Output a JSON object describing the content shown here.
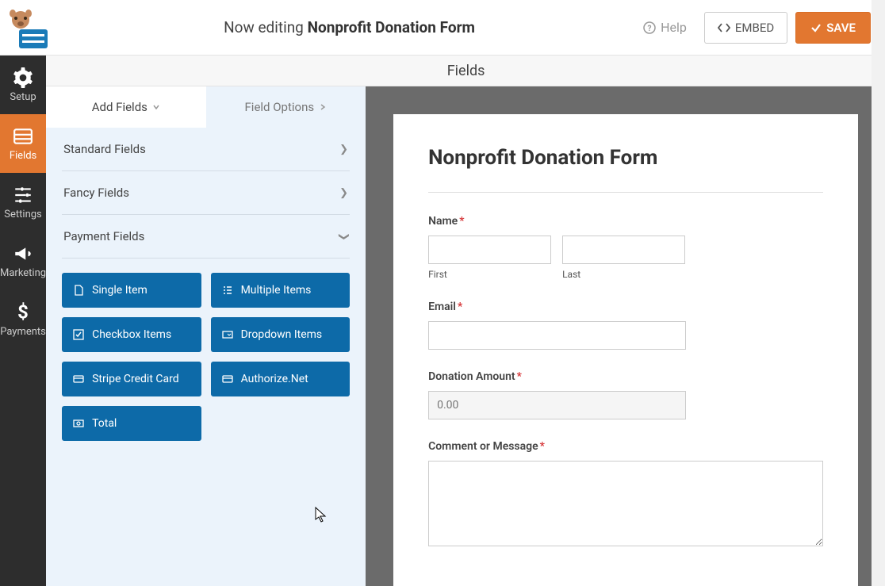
{
  "top": {
    "editing_prefix": "Now editing ",
    "form_name": "Nonprofit Donation Form",
    "help": "Help",
    "embed": "EMBED",
    "save": "SAVE"
  },
  "nav": {
    "setup": "Setup",
    "fields": "Fields",
    "settings": "Settings",
    "marketing": "Marketing",
    "payments": "Payments"
  },
  "panel": {
    "header": "Fields",
    "tab_add": "Add Fields",
    "tab_options": "Field Options",
    "group_standard": "Standard Fields",
    "group_fancy": "Fancy Fields",
    "group_payment": "Payment Fields",
    "buttons": {
      "single_item": "Single Item",
      "multiple_items": "Multiple Items",
      "checkbox_items": "Checkbox Items",
      "dropdown_items": "Dropdown Items",
      "stripe": "Stripe Credit Card",
      "authorize": "Authorize.Net",
      "total": "Total"
    }
  },
  "form": {
    "title": "Nonprofit Donation Form",
    "name_label": "Name",
    "first": "First",
    "last": "Last",
    "email_label": "Email",
    "donation_label": "Donation Amount",
    "donation_placeholder": "0.00",
    "comment_label": "Comment or Message"
  }
}
